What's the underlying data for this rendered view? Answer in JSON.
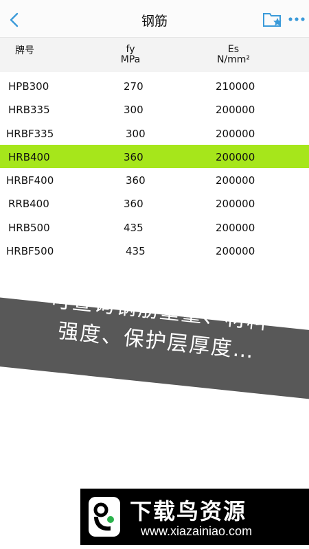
{
  "navbar": {
    "title": "钢筋",
    "back_icon": "chevron-left-icon",
    "folder_icon": "folder-star-icon",
    "more_icon": "more-dots-icon",
    "accent_color": "#3a9ad9"
  },
  "table": {
    "headers": {
      "grade": "牌号",
      "fy": "fy",
      "fy_unit": "MPa",
      "es": "Es",
      "es_unit": "N/mm²"
    },
    "rows": [
      {
        "grade": "HPB300",
        "fy": "270",
        "es": "210000"
      },
      {
        "grade": "HRB335",
        "fy": "300",
        "es": "200000"
      },
      {
        "grade": "HRBF335",
        "fy": "300",
        "es": "200000"
      },
      {
        "grade": "HRB400",
        "fy": "360",
        "es": "200000"
      },
      {
        "grade": "HRBF400",
        "fy": "360",
        "es": "200000"
      },
      {
        "grade": "RRB400",
        "fy": "360",
        "es": "200000"
      },
      {
        "grade": "HRB500",
        "fy": "435",
        "es": "200000"
      },
      {
        "grade": "HRBF500",
        "fy": "435",
        "es": "200000"
      }
    ],
    "highlight_color": "#a6e61b"
  },
  "banner": {
    "line1": "可查询钢筋重量、材料",
    "line2": "强度、保护层厚度…"
  },
  "footer": {
    "name": "下载鸟资源",
    "url": "www.xiazainiao.com"
  }
}
